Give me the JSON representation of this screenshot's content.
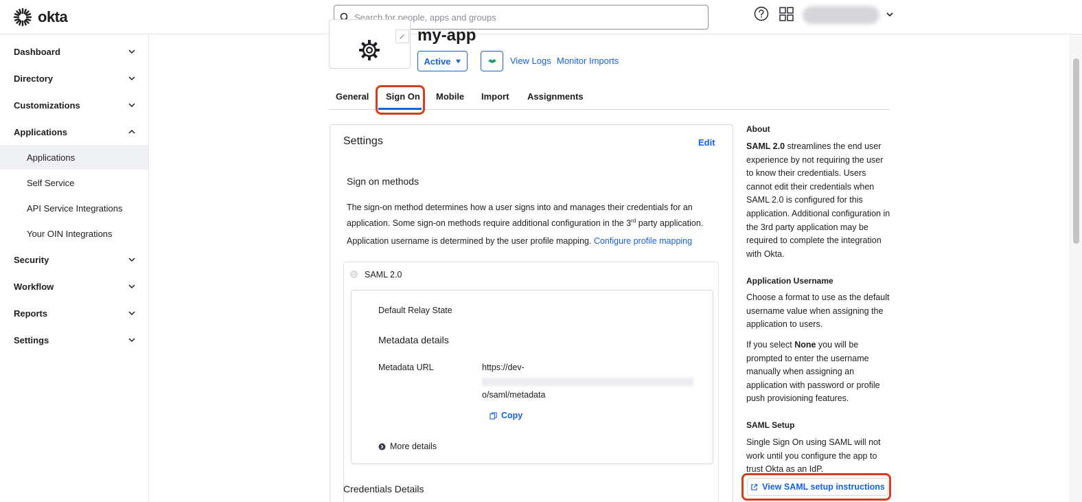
{
  "topbar": {
    "logo_text": "okta",
    "search_placeholder": "Search for people, apps and groups"
  },
  "sidebar": {
    "items": [
      {
        "label": "Dashboard",
        "expanded": false
      },
      {
        "label": "Directory",
        "expanded": false
      },
      {
        "label": "Customizations",
        "expanded": false
      },
      {
        "label": "Applications",
        "expanded": true
      },
      {
        "label": "Security",
        "expanded": false
      },
      {
        "label": "Workflow",
        "expanded": false
      },
      {
        "label": "Reports",
        "expanded": false
      },
      {
        "label": "Settings",
        "expanded": false
      }
    ],
    "sub_items": [
      {
        "label": "Applications",
        "active": true
      },
      {
        "label": "Self Service",
        "active": false
      },
      {
        "label": "API Service Integrations",
        "active": false
      },
      {
        "label": "Your OIN Integrations",
        "active": false
      }
    ]
  },
  "app": {
    "name": "my-app",
    "status": "Active",
    "view_logs": "View Logs",
    "monitor_imports": "Monitor Imports"
  },
  "tabs": [
    {
      "label": "General",
      "active": false
    },
    {
      "label": "Sign On",
      "active": true
    },
    {
      "label": "Mobile",
      "active": false
    },
    {
      "label": "Import",
      "active": false
    },
    {
      "label": "Assignments",
      "active": false
    }
  ],
  "settings": {
    "title": "Settings",
    "edit": "Edit",
    "sign_on_title": "Sign on methods",
    "desc_line1": "The sign-on method determines how a user signs into and manages their credentials for an",
    "desc_line2_a": "application. Some sign-on methods require additional configuration in the 3",
    "desc_line2_sup": "rd",
    "desc_line2_b": " party application.",
    "username_text": "Application username is determined by the user profile mapping.",
    "configure_link": "Configure profile mapping",
    "saml_label": "SAML 2.0",
    "relay_state": "Default Relay State",
    "metadata_title": "Metadata details",
    "metadata_url_label": "Metadata URL",
    "metadata_url_start": "https://dev-",
    "metadata_url_end": "o/saml/metadata",
    "copy": "Copy",
    "more_details": "More details",
    "credentials_title": "Credentials Details"
  },
  "about": {
    "about_title": "About",
    "about_bold": "SAML 2.0",
    "about_text": " streamlines the end user experience by not requiring the user to know their credentials. Users cannot edit their credentials when SAML 2.0 is configured for this application. Additional configuration in the 3rd party application may be required to complete the integration with Okta.",
    "username_title": "Application Username",
    "username_text": "Choose a format to use as the default username value when assigning the application to users.",
    "none_pre": "If you select ",
    "none_bold": "None",
    "none_post": " you will be prompted to enter the username manually when assigning an application with password or profile push provisioning features.",
    "saml_setup_title": "SAML Setup",
    "saml_setup_text": "Single Sign On using SAML will not work until you configure the app to trust Okta as an IdP.",
    "view_instructions": "View SAML setup instructions"
  },
  "colors": {
    "accent": "#1662dd",
    "highlight": "#d43d20"
  }
}
